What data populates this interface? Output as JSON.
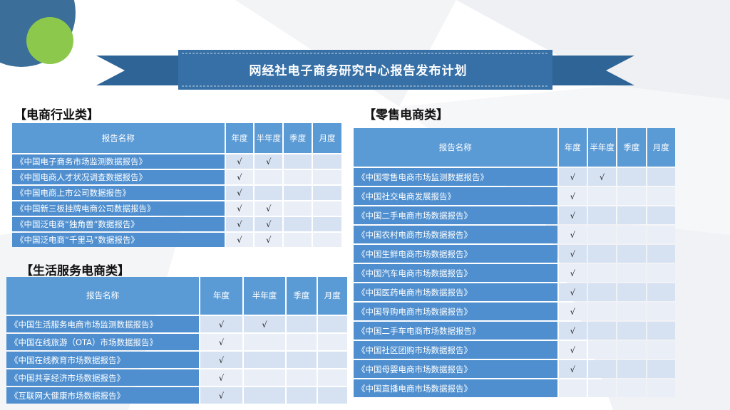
{
  "colors": {
    "header": "#5b9bd5",
    "name_cell": "#4f8fcf",
    "banner": "#2f6596",
    "accent_green": "#8cc84b",
    "circle_dark": "#3b6e98"
  },
  "banner_title": "网经社电子商务研究中心报告发布计划",
  "sections": {
    "industry": {
      "title": "【电商行业类】",
      "headers": [
        "报告名称",
        "年度",
        "半年度",
        "季度",
        "月度"
      ],
      "rows": [
        {
          "name": "《中国电子商务市场监测数据报告》",
          "annual": "√",
          "half": "√",
          "quarter": "",
          "month": ""
        },
        {
          "name": "《中国电商人才状况调查数据报告》",
          "annual": "√",
          "half": "",
          "quarter": "",
          "month": ""
        },
        {
          "name": "《中国电商上市公司数据报告》",
          "annual": "√",
          "half": "",
          "quarter": "",
          "month": ""
        },
        {
          "name": "《中国新三板挂牌电商公司数据报告》",
          "annual": "√",
          "half": "√",
          "quarter": "",
          "month": ""
        },
        {
          "name": "《中国泛电商“独角兽”数据报告》",
          "annual": "√",
          "half": "√",
          "quarter": "",
          "month": ""
        },
        {
          "name": "《中国泛电商“千里马”数据报告》",
          "annual": "√",
          "half": "√",
          "quarter": "",
          "month": ""
        }
      ]
    },
    "life": {
      "title": "【生活服务电商类】",
      "headers": [
        "报告名称",
        "年度",
        "半年度",
        "季度",
        "月度"
      ],
      "rows": [
        {
          "name": "《中国生活服务电商市场监测数据报告》",
          "annual": "√",
          "half": "√",
          "quarter": "",
          "month": ""
        },
        {
          "name": "《中国在线旅游（OTA）市场数据报告》",
          "annual": "√",
          "half": "",
          "quarter": "",
          "month": ""
        },
        {
          "name": "《中国在线教育市场数据报告》",
          "annual": "√",
          "half": "",
          "quarter": "",
          "month": ""
        },
        {
          "name": "《中国共享经济市场数据报告》",
          "annual": "√",
          "half": "",
          "quarter": "",
          "month": ""
        },
        {
          "name": "《互联网大健康市场数据报告》",
          "annual": "√",
          "half": "",
          "quarter": "",
          "month": ""
        }
      ]
    },
    "retail": {
      "title": "【零售电商类】",
      "headers": [
        "报告名称",
        "年度",
        "半年度",
        "季度",
        "月度"
      ],
      "rows": [
        {
          "name": "《中国零售电商市场监测数据报告》",
          "annual": "√",
          "half": "√",
          "quarter": "",
          "month": ""
        },
        {
          "name": "《中国社交电商发展报告》",
          "annual": "√",
          "half": "",
          "quarter": "",
          "month": ""
        },
        {
          "name": "《中国二手电商市场数据报告》",
          "annual": "√",
          "half": "",
          "quarter": "",
          "month": ""
        },
        {
          "name": "《中国农村电商市场数据报告》",
          "annual": "√",
          "half": "",
          "quarter": "",
          "month": ""
        },
        {
          "name": "《中国生鲜电商市场数据报告》",
          "annual": "√",
          "half": "",
          "quarter": "",
          "month": ""
        },
        {
          "name": "《中国汽车电商市场数据报告》",
          "annual": "√",
          "half": "",
          "quarter": "",
          "month": ""
        },
        {
          "name": "《中国医药电商市场数据报告》",
          "annual": "√",
          "half": "",
          "quarter": "",
          "month": ""
        },
        {
          "name": "《中国导购电商市场数据报告》",
          "annual": "√",
          "half": "",
          "quarter": "",
          "month": ""
        },
        {
          "name": "《中国二手车电商市场数据报告》",
          "annual": "√",
          "half": "",
          "quarter": "",
          "month": ""
        },
        {
          "name": "《中国社区团购市场数据报告》",
          "annual": "√",
          "half": "",
          "quarter": "",
          "month": ""
        },
        {
          "name": "《中国母婴电商市场数据报告》",
          "annual": "√",
          "half": "",
          "quarter": "",
          "month": ""
        },
        {
          "name": "《中国直播电商市场数据报告》",
          "annual": "",
          "half": "",
          "quarter": "",
          "month": ""
        }
      ]
    }
  }
}
